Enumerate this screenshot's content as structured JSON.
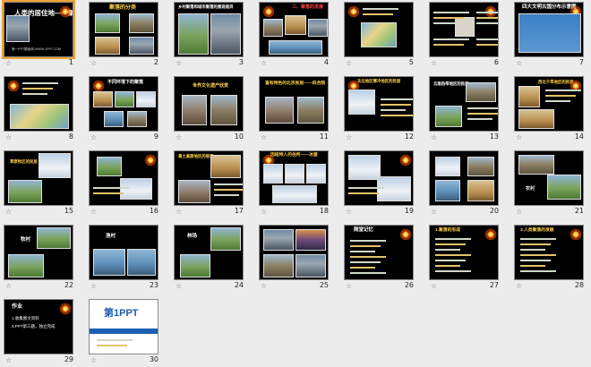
{
  "view": "slide-sorter",
  "slides": [
    {
      "number": "1",
      "title": "人类的居住地——聚落",
      "footer": "第一PPT模板网-WWW.1PPT.COM"
    },
    {
      "number": "2",
      "title": "聚落的分类"
    },
    {
      "number": "3",
      "title": "乡村聚落和城市聚落的景观差异"
    },
    {
      "number": "4",
      "title": "二、聚落的发展"
    },
    {
      "number": "5",
      "title": ""
    },
    {
      "number": "6",
      "title": ""
    },
    {
      "number": "7",
      "title": "四大文明古国分布示意图"
    },
    {
      "number": "8",
      "title": ""
    },
    {
      "number": "9",
      "title": "不同环境下的聚落"
    },
    {
      "number": "10",
      "title": "世界文化遗产欣赏"
    },
    {
      "number": "11",
      "title": "富有特色的北京民居——四合院"
    },
    {
      "number": "12",
      "title": "东北地区寒冷地区的民居"
    },
    {
      "number": "13",
      "title": "云南热带地区的民居"
    },
    {
      "number": "14",
      "title": "西北干旱地区的民居"
    },
    {
      "number": "15",
      "title": "草原牧区的民居"
    },
    {
      "number": "16",
      "title": ""
    },
    {
      "number": "17",
      "title": "黄土高原地区的窑洞"
    },
    {
      "number": "18",
      "title": "因纽特人的住所——冰屋"
    },
    {
      "number": "19",
      "title": ""
    },
    {
      "number": "20",
      "title": ""
    },
    {
      "number": "21",
      "title": "农村"
    },
    {
      "number": "22",
      "title": "牧村"
    },
    {
      "number": "23",
      "title": "渔村"
    },
    {
      "number": "24",
      "title": "林场"
    },
    {
      "number": "25",
      "title": ""
    },
    {
      "number": "26",
      "title": "随堂记忆"
    },
    {
      "number": "27",
      "title": "1.聚落的形成"
    },
    {
      "number": "28",
      "title": "3.人类聚落的发展"
    },
    {
      "number": "29",
      "title": "作业",
      "body": [
        "1.收集图文资料",
        "2.PPT第三题，独立完成"
      ]
    },
    {
      "number": "30",
      "title": "第1PPT"
    }
  ],
  "star_glyph": "☆",
  "colors": {
    "thumbnail_bg": "#000000",
    "title_yellow": "#ffd24a",
    "title_white": "#ffffff",
    "selection": "#f0a030"
  }
}
